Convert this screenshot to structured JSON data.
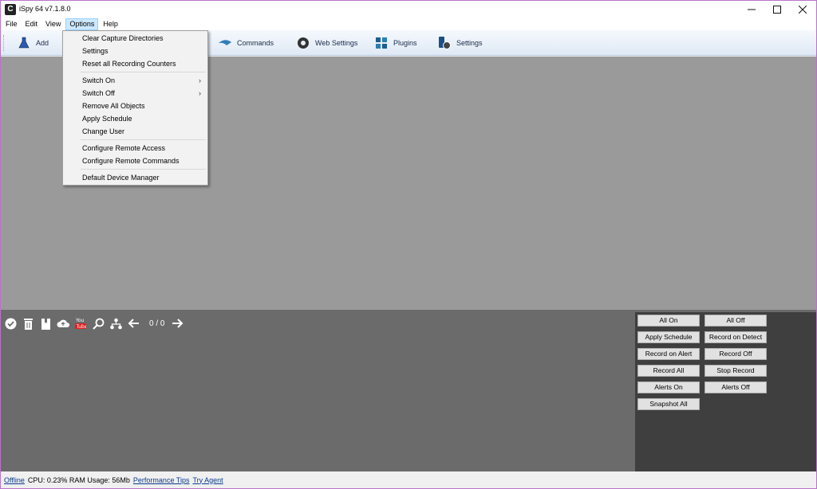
{
  "window": {
    "title": "iSpy 64 v7.1.8.0"
  },
  "menubar": {
    "items": [
      "File",
      "Edit",
      "View",
      "Options",
      "Help"
    ]
  },
  "toolbar": {
    "add": "Add",
    "commands": "Commands",
    "web_settings": "Web Settings",
    "plugins": "Plugins",
    "settings": "Settings"
  },
  "options_menu": {
    "items": [
      "Clear Capture Directories",
      "Settings",
      "Reset all Recording Counters",
      "Switch On",
      "Switch Off",
      "Remove All Objects",
      "Apply Schedule",
      "Change User",
      "Configure Remote Access",
      "Configure Remote Commands",
      "Default Device Manager"
    ]
  },
  "media_toolbar": {
    "counter": "0 / 0"
  },
  "controls": {
    "all_on": "All On",
    "all_off": "All Off",
    "apply_schedule": "Apply Schedule",
    "record_on_detect": "Record on Detect",
    "record_on_alert": "Record on Alert",
    "record_off": "Record Off",
    "record_all": "Record All",
    "stop_record": "Stop Record",
    "alerts_on": "Alerts On",
    "alerts_off": "Alerts Off",
    "snapshot_all": "Snapshot All"
  },
  "statusbar": {
    "offline": "Offline",
    "stats": "CPU: 0.23% RAM Usage: 56Mb",
    "performance_tips": "Performance Tips",
    "try_agent": "Try Agent"
  }
}
